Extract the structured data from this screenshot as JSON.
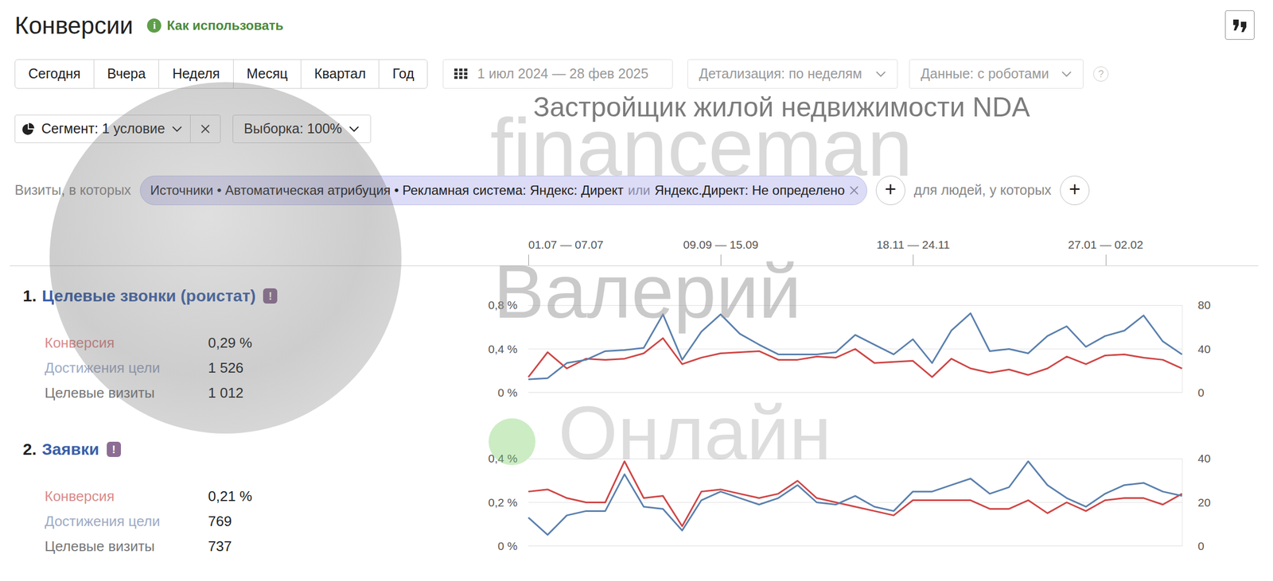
{
  "header": {
    "title": "Конверсии",
    "help_icon": "i",
    "help_link": "Как использовать"
  },
  "periods": [
    {
      "label": "Сегодня",
      "selected": false
    },
    {
      "label": "Вчера",
      "selected": false
    },
    {
      "label": "Неделя",
      "selected": false
    },
    {
      "label": "Месяц",
      "selected": false
    },
    {
      "label": "Квартал",
      "selected": false
    },
    {
      "label": "Год",
      "selected": false
    }
  ],
  "date_range": {
    "label": "1 июл 2024 — 28 фев 2025"
  },
  "detail": {
    "label": "Детализация: по неделям"
  },
  "data_filter": {
    "label": "Данные: с роботами"
  },
  "data_help": "?",
  "segment": {
    "label": "Сегмент: 1 условие"
  },
  "sample": {
    "label": "Выборка: 100%"
  },
  "filters": {
    "visits_label": "Визиты, в которых",
    "condition": {
      "first": "Источники • Автоматическая атрибуция • Рекламная система: Яндекс: Директ",
      "joiner": "или",
      "second": "Яндекс.Директ: Не определено"
    },
    "add_visit": "+",
    "people_label": "для людей, у которых",
    "add_people": "+"
  },
  "timeline": {
    "ticks": [
      {
        "label": "01.07 — 07.07",
        "at": 0
      },
      {
        "label": "09.09 — 15.09",
        "at": 10
      },
      {
        "label": "18.11 — 24.11",
        "at": 20
      },
      {
        "label": "27.01 — 02.02",
        "at": 30
      }
    ]
  },
  "goals": [
    {
      "number": "1.",
      "name": "Целевые звонки (роистат)",
      "badge": "!",
      "metrics": [
        {
          "label": "Конверсия",
          "value": "0,29 %",
          "color": "#d98b8b"
        },
        {
          "label": "Достижения цели",
          "value": "1 526",
          "color": "#9eabc4"
        },
        {
          "label": "Целевые визиты",
          "value": "1 012",
          "color": "#777777"
        }
      ],
      "chart": {
        "left_ticks": [
          "0,8 %",
          "0,4 %",
          "0 %"
        ],
        "right_ticks": [
          "80",
          "40",
          "0"
        ],
        "left_max": 0.8,
        "right_max": 80,
        "series": [
          {
            "axis": "left",
            "color": "#d04545",
            "values": [
              0.14,
              0.37,
              0.22,
              0.31,
              0.3,
              0.31,
              0.36,
              0.5,
              0.26,
              0.32,
              0.36,
              0.37,
              0.38,
              0.3,
              0.3,
              0.33,
              0.32,
              0.4,
              0.27,
              0.28,
              0.29,
              0.14,
              0.31,
              0.22,
              0.18,
              0.21,
              0.16,
              0.22,
              0.33,
              0.26,
              0.34,
              0.35,
              0.32,
              0.3,
              0.22
            ]
          },
          {
            "axis": "right",
            "color": "#5a80ae",
            "values": [
              12,
              13,
              27,
              30,
              38,
              39,
              41,
              72,
              30,
              56,
              72,
              54,
              44,
              35,
              35,
              35,
              37,
              53,
              44,
              35,
              49,
              27,
              57,
              73,
              38,
              40,
              36,
              52,
              61,
              42,
              52,
              57,
              71,
              47,
              35
            ]
          }
        ]
      }
    },
    {
      "number": "2.",
      "name": "Заявки",
      "badge": "!",
      "metrics": [
        {
          "label": "Конверсия",
          "value": "0,21 %",
          "color": "#d98b8b"
        },
        {
          "label": "Достижения цели",
          "value": "769",
          "color": "#9eabc4"
        },
        {
          "label": "Целевые визиты",
          "value": "737",
          "color": "#777777"
        }
      ],
      "chart": {
        "left_ticks": [
          "0,4 %",
          "0,2 %",
          "0 %"
        ],
        "right_ticks": [
          "40",
          "20",
          "0"
        ],
        "left_max": 0.4,
        "right_max": 40,
        "series": [
          {
            "axis": "left",
            "color": "#d04545",
            "values": [
              0.25,
              0.26,
              0.22,
              0.2,
              0.2,
              0.39,
              0.22,
              0.23,
              0.09,
              0.25,
              0.26,
              0.24,
              0.22,
              0.24,
              0.3,
              0.22,
              0.2,
              0.18,
              0.16,
              0.14,
              0.21,
              0.21,
              0.21,
              0.21,
              0.17,
              0.17,
              0.21,
              0.15,
              0.2,
              0.16,
              0.21,
              0.22,
              0.22,
              0.19,
              0.24
            ]
          },
          {
            "axis": "right",
            "color": "#5a80ae",
            "values": [
              13,
              5,
              14,
              16,
              16,
              33,
              18,
              17,
              7,
              21,
              25,
              22,
              19,
              22,
              28,
              20,
              19,
              23,
              18,
              16,
              25,
              25,
              28,
              31,
              24,
              27,
              39,
              28,
              22,
              18,
              24,
              28,
              29,
              25,
              23
            ]
          }
        ]
      }
    }
  ],
  "watermark": {
    "company": "Застройщик жилой недвижимости NDA",
    "brand": "financeman",
    "person": "Валерий",
    "status": "Онлайн",
    "online": true
  }
}
